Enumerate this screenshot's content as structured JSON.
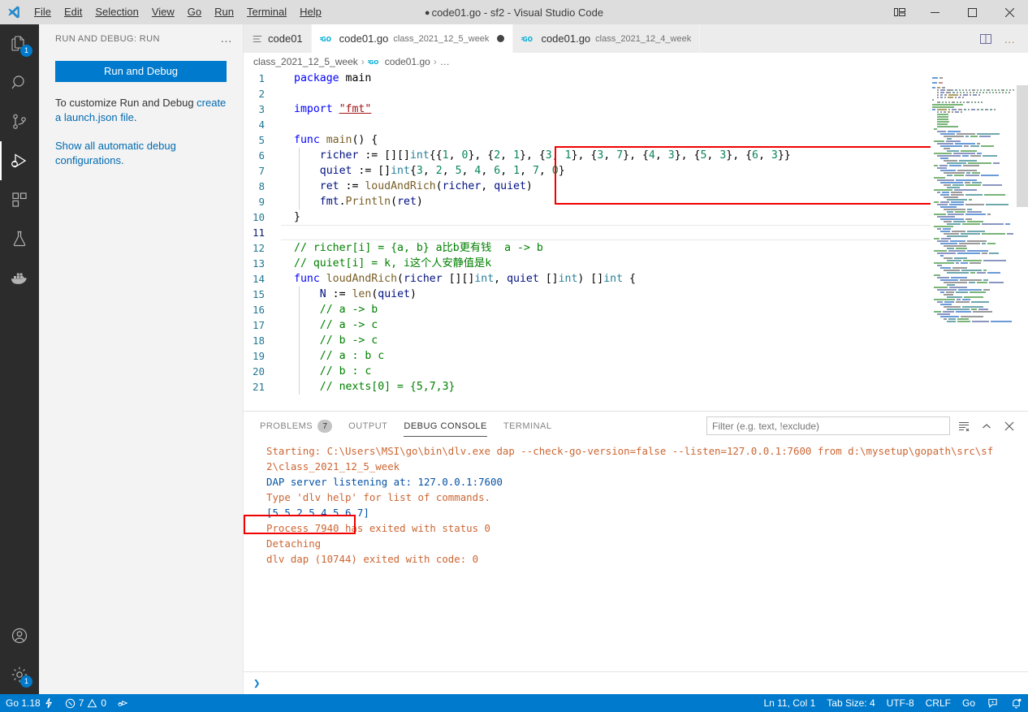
{
  "titlebar": {
    "title": "code01.go - sf2 - Visual Studio Code",
    "dirty_marker": "●",
    "menus": [
      "File",
      "Edit",
      "Selection",
      "View",
      "Go",
      "Run",
      "Terminal",
      "Help"
    ],
    "controls": {
      "layout": "customize-layout",
      "minimize": "—",
      "maximize": "▢",
      "close": "✕"
    }
  },
  "activitybar": {
    "items": [
      {
        "name": "explorer",
        "badge": "1"
      },
      {
        "name": "search",
        "badge": ""
      },
      {
        "name": "source-control",
        "badge": ""
      },
      {
        "name": "run-and-debug",
        "badge": "",
        "active": true
      },
      {
        "name": "extensions",
        "badge": ""
      },
      {
        "name": "testing",
        "badge": ""
      },
      {
        "name": "docker",
        "badge": ""
      }
    ],
    "bottom": [
      {
        "name": "accounts",
        "badge": ""
      },
      {
        "name": "manage-settings",
        "badge": "1"
      }
    ]
  },
  "sidebar": {
    "header": "RUN AND DEBUG: RUN",
    "more_label": "…",
    "run_button": "Run and Debug",
    "hint_prefix": "To customize Run and Debug ",
    "hint_link": "create a launch.json file",
    "hint_suffix": ".",
    "show_all_link": "Show all automatic debug configurations."
  },
  "tabs": [
    {
      "label": "code01",
      "desc": "",
      "icon": "list-icon",
      "active": false,
      "dirty": false
    },
    {
      "label": "code01.go",
      "desc": "class_2021_12_5_week",
      "icon": "go-icon",
      "active": true,
      "dirty": true
    },
    {
      "label": "code01.go",
      "desc": "class_2021_12_4_week",
      "icon": "go-icon",
      "active": false,
      "dirty": false
    }
  ],
  "tab_actions": {
    "split": "split-editor",
    "more": "…"
  },
  "breadcrumb": {
    "folder": "class_2021_12_5_week",
    "file": "code01.go",
    "last": "…",
    "sep": "›"
  },
  "editor": {
    "cursor_line": 11,
    "lines": [
      {
        "n": 1,
        "tokens": [
          {
            "t": "package ",
            "c": "kw"
          },
          {
            "t": "main",
            "c": "plain"
          }
        ]
      },
      {
        "n": 2,
        "tokens": []
      },
      {
        "n": 3,
        "tokens": [
          {
            "t": "import ",
            "c": "kw"
          },
          {
            "t": "\"fmt\"",
            "c": "str"
          }
        ]
      },
      {
        "n": 4,
        "tokens": []
      },
      {
        "n": 5,
        "tokens": [
          {
            "t": "func ",
            "c": "kw"
          },
          {
            "t": "main",
            "c": "fn"
          },
          {
            "t": "() {",
            "c": "plain"
          }
        ]
      },
      {
        "n": 6,
        "indent": 1,
        "tokens": [
          {
            "t": "    ",
            "c": "plain"
          },
          {
            "t": "richer",
            "c": "var"
          },
          {
            "t": " := [][]",
            "c": "plain"
          },
          {
            "t": "int",
            "c": "type"
          },
          {
            "t": "{{",
            "c": "plain"
          },
          {
            "t": "1",
            "c": "num"
          },
          {
            "t": ", ",
            "c": "plain"
          },
          {
            "t": "0",
            "c": "num"
          },
          {
            "t": "}, {",
            "c": "plain"
          },
          {
            "t": "2",
            "c": "num"
          },
          {
            "t": ", ",
            "c": "plain"
          },
          {
            "t": "1",
            "c": "num"
          },
          {
            "t": "}, {",
            "c": "plain"
          },
          {
            "t": "3",
            "c": "num"
          },
          {
            "t": ", ",
            "c": "plain"
          },
          {
            "t": "1",
            "c": "num"
          },
          {
            "t": "}, {",
            "c": "plain"
          },
          {
            "t": "3",
            "c": "num"
          },
          {
            "t": ", ",
            "c": "plain"
          },
          {
            "t": "7",
            "c": "num"
          },
          {
            "t": "}, {",
            "c": "plain"
          },
          {
            "t": "4",
            "c": "num"
          },
          {
            "t": ", ",
            "c": "plain"
          },
          {
            "t": "3",
            "c": "num"
          },
          {
            "t": "}, {",
            "c": "plain"
          },
          {
            "t": "5",
            "c": "num"
          },
          {
            "t": ", ",
            "c": "plain"
          },
          {
            "t": "3",
            "c": "num"
          },
          {
            "t": "}, {",
            "c": "plain"
          },
          {
            "t": "6",
            "c": "num"
          },
          {
            "t": ", ",
            "c": "plain"
          },
          {
            "t": "3",
            "c": "num"
          },
          {
            "t": "}}",
            "c": "plain"
          }
        ]
      },
      {
        "n": 7,
        "indent": 1,
        "tokens": [
          {
            "t": "    ",
            "c": "plain"
          },
          {
            "t": "quiet",
            "c": "var"
          },
          {
            "t": " := []",
            "c": "plain"
          },
          {
            "t": "int",
            "c": "type"
          },
          {
            "t": "{",
            "c": "plain"
          },
          {
            "t": "3",
            "c": "num"
          },
          {
            "t": ", ",
            "c": "plain"
          },
          {
            "t": "2",
            "c": "num"
          },
          {
            "t": ", ",
            "c": "plain"
          },
          {
            "t": "5",
            "c": "num"
          },
          {
            "t": ", ",
            "c": "plain"
          },
          {
            "t": "4",
            "c": "num"
          },
          {
            "t": ", ",
            "c": "plain"
          },
          {
            "t": "6",
            "c": "num"
          },
          {
            "t": ", ",
            "c": "plain"
          },
          {
            "t": "1",
            "c": "num"
          },
          {
            "t": ", ",
            "c": "plain"
          },
          {
            "t": "7",
            "c": "num"
          },
          {
            "t": ", ",
            "c": "plain"
          },
          {
            "t": "0",
            "c": "num"
          },
          {
            "t": "}",
            "c": "plain"
          }
        ]
      },
      {
        "n": 8,
        "indent": 1,
        "tokens": [
          {
            "t": "    ",
            "c": "plain"
          },
          {
            "t": "ret",
            "c": "var"
          },
          {
            "t": " := ",
            "c": "plain"
          },
          {
            "t": "loudAndRich",
            "c": "fn"
          },
          {
            "t": "(",
            "c": "plain"
          },
          {
            "t": "richer",
            "c": "var"
          },
          {
            "t": ", ",
            "c": "plain"
          },
          {
            "t": "quiet",
            "c": "var"
          },
          {
            "t": ")",
            "c": "plain"
          }
        ]
      },
      {
        "n": 9,
        "indent": 1,
        "tokens": [
          {
            "t": "    ",
            "c": "plain"
          },
          {
            "t": "fmt",
            "c": "var"
          },
          {
            "t": ".",
            "c": "plain"
          },
          {
            "t": "Println",
            "c": "fn"
          },
          {
            "t": "(",
            "c": "plain"
          },
          {
            "t": "ret",
            "c": "var"
          },
          {
            "t": ")",
            "c": "plain"
          }
        ]
      },
      {
        "n": 10,
        "tokens": [
          {
            "t": "}",
            "c": "plain"
          }
        ]
      },
      {
        "n": 11,
        "tokens": []
      },
      {
        "n": 12,
        "tokens": [
          {
            "t": "// richer[i] = {a, b} a比b更有钱  a -> b",
            "c": "com"
          }
        ]
      },
      {
        "n": 13,
        "tokens": [
          {
            "t": "// quiet[i] = k, i这个人安静值是k",
            "c": "com"
          }
        ]
      },
      {
        "n": 14,
        "tokens": [
          {
            "t": "func ",
            "c": "kw"
          },
          {
            "t": "loudAndRich",
            "c": "fn"
          },
          {
            "t": "(",
            "c": "plain"
          },
          {
            "t": "richer",
            "c": "var"
          },
          {
            "t": " [][]",
            "c": "plain"
          },
          {
            "t": "int",
            "c": "type"
          },
          {
            "t": ", ",
            "c": "plain"
          },
          {
            "t": "quiet",
            "c": "var"
          },
          {
            "t": " []",
            "c": "plain"
          },
          {
            "t": "int",
            "c": "type"
          },
          {
            "t": ") []",
            "c": "plain"
          },
          {
            "t": "int",
            "c": "type"
          },
          {
            "t": " {",
            "c": "plain"
          }
        ]
      },
      {
        "n": 15,
        "indent": 1,
        "tokens": [
          {
            "t": "    ",
            "c": "plain"
          },
          {
            "t": "N",
            "c": "var"
          },
          {
            "t": " := ",
            "c": "plain"
          },
          {
            "t": "len",
            "c": "fn"
          },
          {
            "t": "(",
            "c": "plain"
          },
          {
            "t": "quiet",
            "c": "var"
          },
          {
            "t": ")",
            "c": "plain"
          }
        ]
      },
      {
        "n": 16,
        "indent": 1,
        "tokens": [
          {
            "t": "    // a -> b",
            "c": "com"
          }
        ]
      },
      {
        "n": 17,
        "indent": 1,
        "tokens": [
          {
            "t": "    // a -> c",
            "c": "com"
          }
        ]
      },
      {
        "n": 18,
        "indent": 1,
        "tokens": [
          {
            "t": "    // b -> c",
            "c": "com"
          }
        ]
      },
      {
        "n": 19,
        "indent": 1,
        "tokens": [
          {
            "t": "    // a : b c",
            "c": "com"
          }
        ]
      },
      {
        "n": 20,
        "indent": 1,
        "tokens": [
          {
            "t": "    // b : c",
            "c": "com"
          }
        ]
      },
      {
        "n": 21,
        "indent": 1,
        "tokens": [
          {
            "t": "    // nexts[0] = {5,7,3}",
            "c": "com"
          }
        ]
      }
    ]
  },
  "panel": {
    "tabs": [
      {
        "label": "PROBLEMS",
        "count": "7",
        "active": false
      },
      {
        "label": "OUTPUT",
        "count": "",
        "active": false
      },
      {
        "label": "DEBUG CONSOLE",
        "count": "",
        "active": true
      },
      {
        "label": "TERMINAL",
        "count": "",
        "active": false
      }
    ],
    "filter_placeholder": "Filter (e.g. text, !exclude)",
    "filter_value": "",
    "actions": {
      "clear": "clear-console",
      "collapse": "^",
      "close": "✕"
    },
    "console_lines": [
      {
        "text": "Starting: C:\\Users\\MSI\\go\\bin\\dlv.exe dap --check-go-version=false --listen=127.0.0.1:7600 from d:\\mysetup\\gopath\\src\\sf",
        "color": "orange"
      },
      {
        "text": "2\\class_2021_12_5_week",
        "color": "orange"
      },
      {
        "text": "DAP server listening at: 127.0.0.1:7600",
        "color": "blue"
      },
      {
        "text": "Type 'dlv help' for list of commands.",
        "color": "orange"
      },
      {
        "text": "[5 5 2 5 4 5 6 7]",
        "color": "blue"
      },
      {
        "text": "Process 7940 has exited with status 0",
        "color": "orange"
      },
      {
        "text": "Detaching",
        "color": "orange"
      },
      {
        "text": "dlv dap (10744) exited with code: 0",
        "color": "orange"
      }
    ],
    "prompt": "❯"
  },
  "statusbar": {
    "left": [
      {
        "name": "go-version",
        "label": "Go 1.18",
        "icon": "lightning-icon"
      },
      {
        "name": "problems",
        "label": "7",
        "label2": "0",
        "icon": "error-warning-icon"
      },
      {
        "name": "go-test",
        "label": "",
        "icon": "beaker-run-icon"
      }
    ],
    "right": [
      {
        "name": "cursor-position",
        "label": "Ln 11, Col 1"
      },
      {
        "name": "tab-size",
        "label": "Tab Size: 4"
      },
      {
        "name": "encoding",
        "label": "UTF-8"
      },
      {
        "name": "eol",
        "label": "CRLF"
      },
      {
        "name": "language-mode",
        "label": "Go"
      },
      {
        "name": "feedback",
        "label": "",
        "icon": "feedback-icon"
      },
      {
        "name": "notifications",
        "label": "",
        "icon": "bell-dot-icon"
      }
    ]
  },
  "annotations": {
    "code_box": "highlight around lines 6-9",
    "output_box": "highlight around result [5 5 2 5 4 5 6 7]"
  },
  "colors": {
    "accent": "#007acc",
    "annotation": "#f00000",
    "activitybar_bg": "#2c2c2c",
    "sidebar_bg": "#f3f3f3",
    "titlebar_bg": "#dddddd"
  }
}
